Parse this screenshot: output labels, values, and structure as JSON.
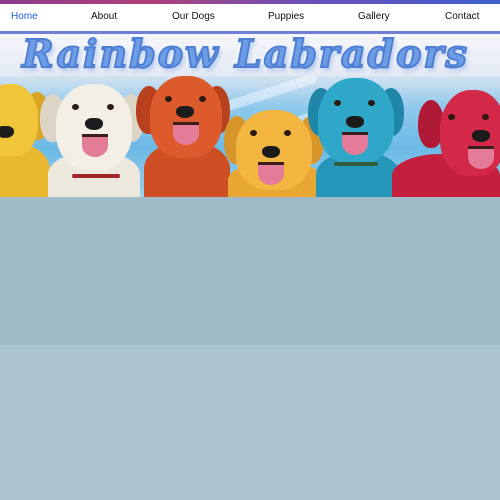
{
  "nav": {
    "items": [
      {
        "label": "Home",
        "active": true
      },
      {
        "label": "About"
      },
      {
        "label": "Our Dogs"
      },
      {
        "label": "Puppies"
      },
      {
        "label": "Gallery"
      },
      {
        "label": "Contact"
      }
    ]
  },
  "banner": {
    "title": "Rainbow Labradors",
    "dogs": [
      {
        "name": "yellow-labrador",
        "color": "#f0c53a"
      },
      {
        "name": "white-labrador",
        "color": "#f1ede4"
      },
      {
        "name": "red-labrador",
        "color": "#dd5a2c"
      },
      {
        "name": "golden-labrador",
        "color": "#f3b640"
      },
      {
        "name": "blue-labrador",
        "color": "#2fa7c9"
      },
      {
        "name": "crimson-labrador",
        "color": "#d42848"
      }
    ]
  },
  "colors": {
    "nav_active": "#1e5bd6",
    "nav_border": "#6f7fd6",
    "title": "#6e9de6",
    "page_band_1": "#a0bcc8",
    "page_band_2": "#acc4d0"
  }
}
